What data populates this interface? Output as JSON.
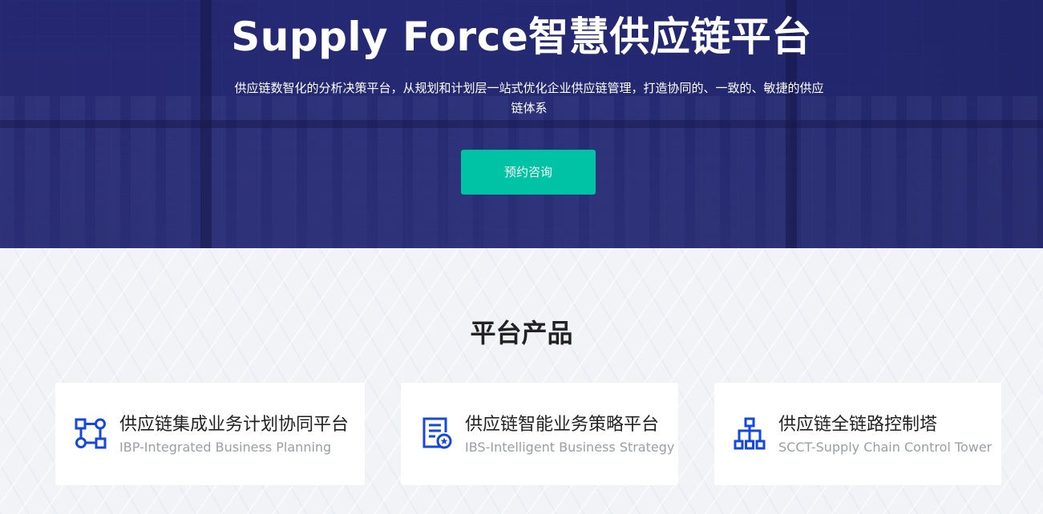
{
  "hero": {
    "title": "Supply Force智慧供应链平台",
    "description": "供应链数智化的分析决策平台，从规划和计划层一站式优化企业供应链管理，打造协同的、一致的、敏捷的供应链体系",
    "cta_label": "预约咨询",
    "cta_color": "#00c3a5"
  },
  "products": {
    "title": "平台产品",
    "items": [
      {
        "name": "供应链集成业务计划协同平台",
        "subtitle": "IBP-Integrated Business Planning",
        "icon": "flow-nodes-icon"
      },
      {
        "name": "供应链智能业务策略平台",
        "subtitle": "IBS-Intelligent Business Strategy",
        "icon": "document-badge-icon"
      },
      {
        "name": "供应链全链路控制塔",
        "subtitle": "SCCT-Supply Chain Control Tower",
        "icon": "org-tree-icon"
      }
    ],
    "icon_color": "#1547e0"
  }
}
